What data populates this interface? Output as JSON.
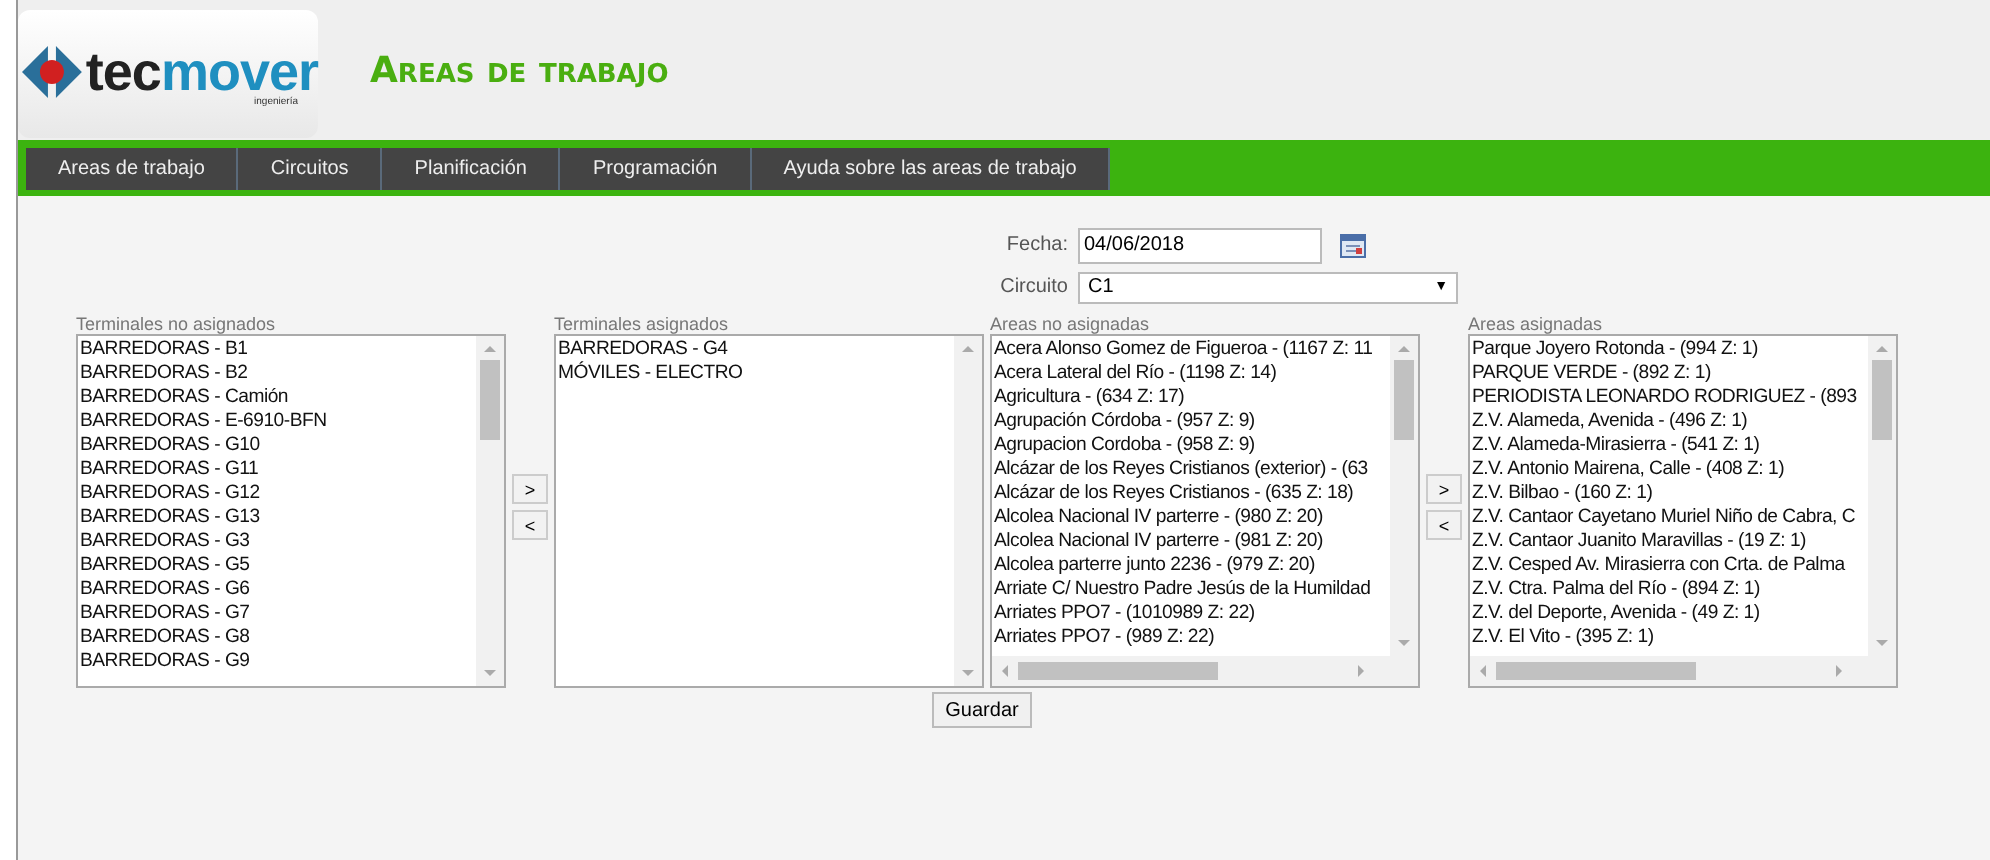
{
  "header": {
    "logo_text": "tec",
    "logo_text_accent": "mover",
    "logo_subtitle": "ingeniería",
    "title": "Areas de trabajo"
  },
  "nav": [
    "Areas de trabajo",
    "Circuitos",
    "Planificación",
    "Programación",
    "Ayuda sobre las areas de trabajo"
  ],
  "form": {
    "date_label": "Fecha:",
    "date_value": "04/06/2018",
    "circuit_label": "Circuito",
    "circuit_value": "C1",
    "circuit_caret": "▼"
  },
  "lists": [
    {
      "label": "Terminales no asignados",
      "hscroll": false,
      "items": [
        "BARREDORAS - B1",
        "BARREDORAS - B2",
        "BARREDORAS - Camión",
        "BARREDORAS - E-6910-BFN",
        "BARREDORAS - G10",
        "BARREDORAS - G11",
        "BARREDORAS - G12",
        "BARREDORAS - G13",
        "BARREDORAS - G3",
        "BARREDORAS - G5",
        "BARREDORAS - G6",
        "BARREDORAS - G7",
        "BARREDORAS - G8",
        "BARREDORAS - G9"
      ]
    },
    {
      "label": "Terminales asignados",
      "hscroll": false,
      "items": [
        "BARREDORAS - G4",
        "MÓVILES - ELECTRO"
      ]
    },
    {
      "label": "Areas no asignadas",
      "hscroll": true,
      "items": [
        "Acera Alonso Gomez de Figueroa - (1167 Z: 11",
        "Acera Lateral del Río - (1198 Z: 14)",
        "Agricultura - (634 Z: 17)",
        "Agrupación Córdoba - (957 Z: 9)",
        "Agrupacion Cordoba - (958 Z: 9)",
        "Alcázar de los Reyes Cristianos (exterior) - (63",
        "Alcázar de los Reyes Cristianos - (635 Z: 18)",
        "Alcolea Nacional IV parterre - (980 Z: 20)",
        "Alcolea Nacional IV parterre - (981 Z: 20)",
        "Alcolea parterre junto 2236 - (979 Z: 20)",
        "Arriate C/ Nuestro Padre Jesús de la Humildad",
        "Arriates PPO7 - (1010989 Z: 22)",
        "Arriates PPO7 - (989 Z: 22)"
      ]
    },
    {
      "label": "Areas asignadas",
      "hscroll": true,
      "items": [
        "Parque Joyero Rotonda - (994 Z: 1)",
        "PARQUE VERDE - (892 Z: 1)",
        "PERIODISTA LEONARDO RODRIGUEZ - (893",
        "Z.V. Alameda, Avenida - (496 Z: 1)",
        "Z.V. Alameda-Mirasierra - (541 Z: 1)",
        "Z.V. Antonio Mairena, Calle - (408 Z: 1)",
        "Z.V. Bilbao - (160 Z: 1)",
        "Z.V. Cantaor Cayetano Muriel Niño de Cabra, C",
        "Z.V. Cantaor Juanito Maravillas - (19 Z: 1)",
        "Z.V. Cesped Av. Mirasierra con Crta. de Palma",
        "Z.V. Ctra. Palma del Río - (894 Z: 1)",
        "Z.V. del Deporte, Avenida - (49 Z: 1)",
        "Z.V. El Vito - (395 Z: 1)"
      ]
    }
  ],
  "move_buttons": [
    ">",
    "<"
  ],
  "save_button": "Guardar"
}
